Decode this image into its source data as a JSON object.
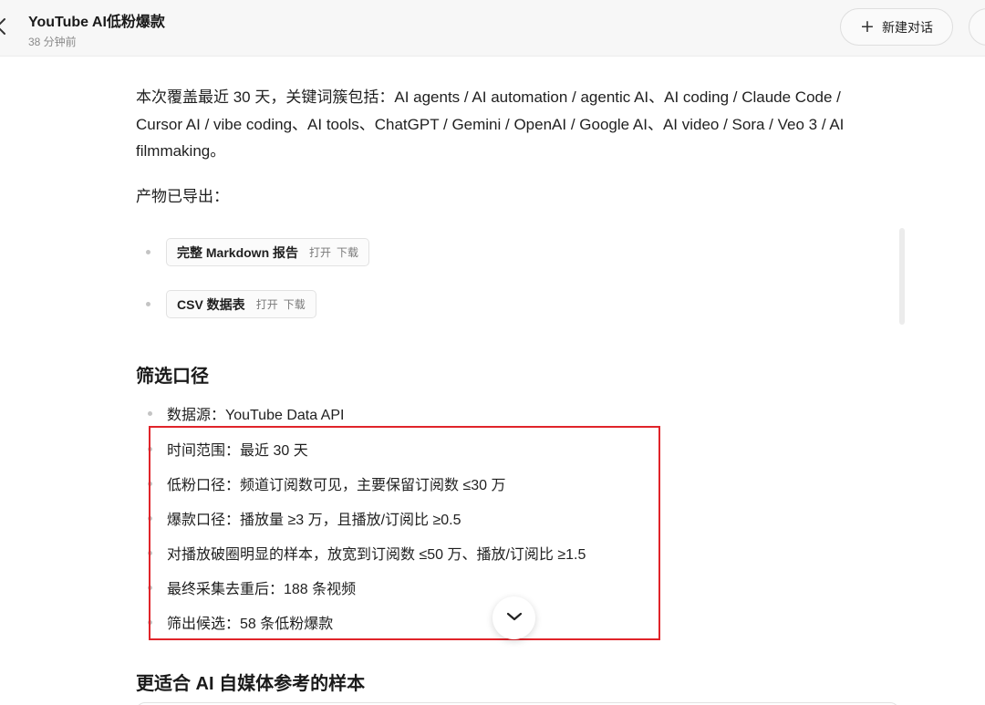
{
  "header": {
    "title": "YouTube AI低粉爆款",
    "time_ago": "38 分钟前",
    "new_chat_label": "新建对话",
    "back_icon": "chevron-left-icon",
    "new_chat_icon": "plus-icon"
  },
  "intro": "本次覆盖最近 30 天，关键词簇包括：AI agents / AI automation / agentic AI、AI coding / Claude Code / Cursor AI / vibe coding、AI tools、ChatGPT / Gemini / OpenAI / Google AI、AI video / Sora / Veo 3 / AI filmmaking。",
  "exported_label": "产物已导出：",
  "files": [
    {
      "name": "完整 Markdown 报告",
      "open": "打开",
      "download": "下载"
    },
    {
      "name": "CSV 数据表",
      "open": "打开",
      "download": "下载"
    }
  ],
  "section1": {
    "heading": "筛选口径",
    "items": [
      "数据源：YouTube Data API",
      "时间范围：最近 30 天",
      "低粉口径：频道订阅数可见，主要保留订阅数 ≤30 万",
      "爆款口径：播放量 ≥3 万，且播放/订阅比 ≥0.5",
      "对播放破圈明显的样本，放宽到订阅数 ≤50 万、播放/订阅比 ≥1.5",
      "最终采集去重后：188 条视频",
      "筛出候选：58 条低粉爆款"
    ]
  },
  "section2": {
    "heading": "更适合 AI 自媒体参考的样本"
  },
  "colors": {
    "highlight_border": "#e0242a",
    "header_bg": "#f7f7f7"
  },
  "scroll_down_icon": "chevron-down-icon"
}
